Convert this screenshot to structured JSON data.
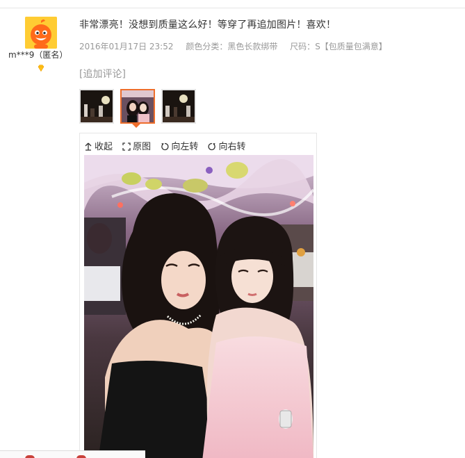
{
  "user": {
    "name": "m***9（匿名）",
    "avatar_icon": "orange-mascot-avatar",
    "badge_icon": "diamond-level-icon",
    "badge_color": "#ffc21a"
  },
  "comment": {
    "text": "非常漂亮！没想到质量这么好！等穿了再追加图片！喜欢！",
    "date": "2016年01月17日 23:52",
    "color_label": "颜色分类：",
    "color_value": "黑色长款绑带",
    "size_label": "尺码：",
    "size_value": "S【包质量包满意】"
  },
  "append": {
    "title": "[追加评论]",
    "thumbnails": [
      {
        "name": "thumbnail-1",
        "selected": false
      },
      {
        "name": "thumbnail-2",
        "selected": true
      },
      {
        "name": "thumbnail-3",
        "selected": false
      }
    ]
  },
  "viewer": {
    "collapse_label": "收起",
    "original_label": "原图",
    "rotate_left_label": "向左转",
    "rotate_right_label": "向右转",
    "collapse_icon": "arrow-up-icon",
    "original_icon": "expand-icon",
    "rotate_left_icon": "rotate-left-icon",
    "rotate_right_icon": "rotate-right-icon"
  },
  "colors": {
    "accent": "#ee6e2c",
    "meta_text": "#999999",
    "border": "#e6e6e6"
  }
}
